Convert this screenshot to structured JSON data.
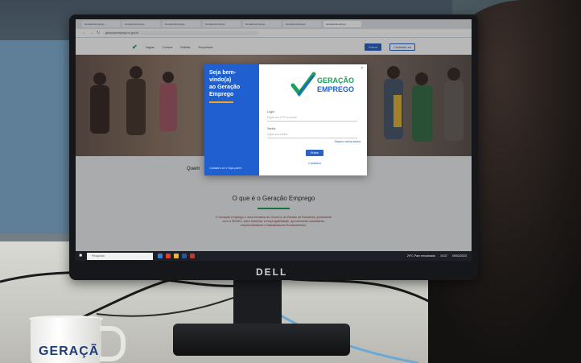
{
  "browser": {
    "tabs": [
      "Geração Emprego",
      "Geração Emprego",
      "Geração Emprego",
      "Geração Emprego",
      "Geração Emprego",
      "Geração Emprego",
      "Geração Emprego"
    ],
    "address": "geracaoemprego.ro.gov.br"
  },
  "site": {
    "nav_items": [
      "Vagas",
      "Cursos",
      "Editais",
      "Empresas"
    ],
    "entrar_label": "Entrar",
    "cadastro_label": "Cadastre-se"
  },
  "modal": {
    "welcome_line1": "Seja bem-vindo(a)",
    "welcome_line2": "ao Geração",
    "welcome_line3": "Emprego",
    "left_footer": "Cadastre-se e faça parte!",
    "logo_line1": "GERAÇÃO",
    "logo_line2": "EMPREGO",
    "login_label": "Login",
    "login_placeholder": "Digite seu CPF ou email",
    "password_label": "Senha",
    "password_placeholder": "Digite sua senha",
    "forgot_label": "Esqueci minha senha",
    "submit_label": "Entrar",
    "register_label": "Cadastrar"
  },
  "page": {
    "quem_label": "Quem",
    "what_title": "O que é o Geração Emprego",
    "what_text": "O Geração Emprego é uma iniciativa do Governo do Estado de Rondônia, juntamente com a SEDEC, para fomentar a empregabilidade, aproximando candidatos, empreendedores e trabalhadores Rondonienses."
  },
  "taskbar": {
    "search_placeholder": "Pesquisar",
    "weather": "29°C Parc ensolarado",
    "time": "10:07",
    "date": "09/02/2023"
  },
  "monitor": {
    "brand": "DELL"
  },
  "mug": {
    "print": "GERAÇÃ"
  },
  "colors": {
    "accent_blue": "#1f5fd0",
    "accent_green": "#19a05a",
    "accent_orange": "#f4a521"
  }
}
